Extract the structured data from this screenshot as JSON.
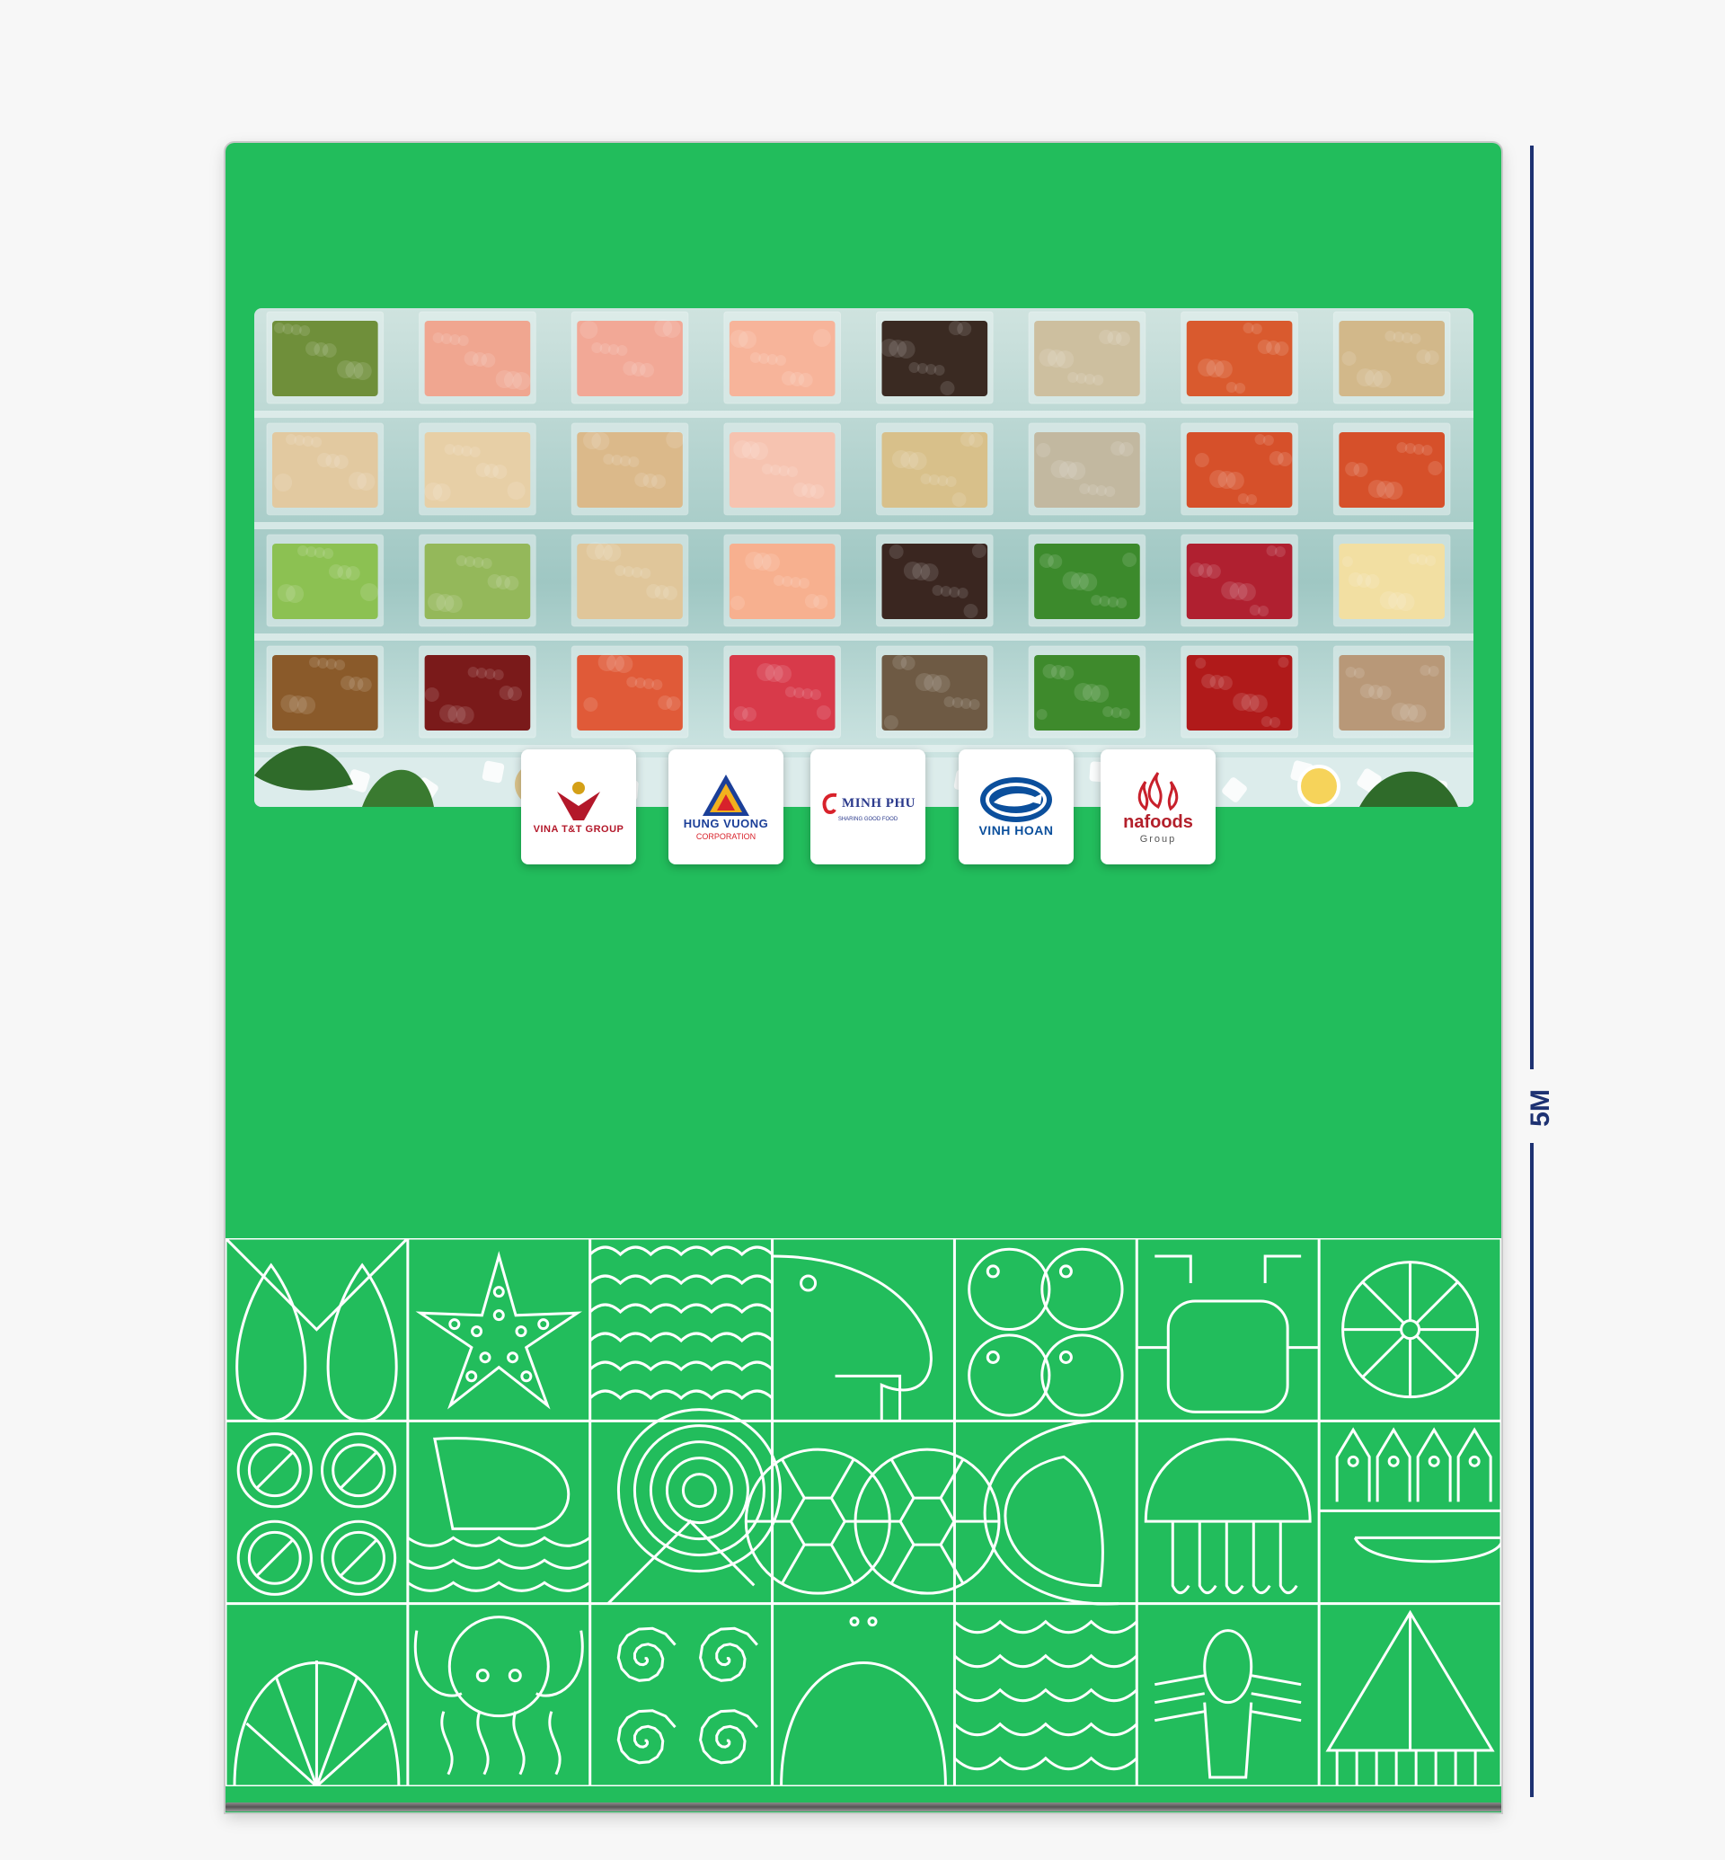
{
  "dimension": {
    "label": "5M",
    "color": "#1e3272"
  },
  "colors": {
    "panel": "#22bd5c",
    "pattern_line": "#ffffff",
    "background": "#f7f7f7"
  },
  "logos": [
    {
      "name": "VINA T&T GROUP",
      "subtitle": "",
      "color": "#b3182a",
      "icon": "person-icon"
    },
    {
      "name": "HUNG VUONG",
      "subtitle": "CORPORATION",
      "color": "#1b3f98",
      "icon": "triangle-icon"
    },
    {
      "name": "MINH PHU",
      "subtitle": "SHARING GOOD FOOD",
      "color": "#2b3a8c",
      "icon": "shrimp-icon"
    },
    {
      "name": "VINH HOAN",
      "subtitle": "",
      "color": "#0b4f9c",
      "icon": "fish-icon"
    },
    {
      "name": "nafoods",
      "subtitle": "Group",
      "color": "#c8202b",
      "icon": "flame-icon"
    }
  ],
  "photo": {
    "description_icons": "food-grid-icon",
    "items": [
      [
        "#6f8f3a",
        "#f0a690",
        "#f2a896",
        "#f7b49a",
        "#3a2a22",
        "#cdbf9f",
        "#d95a2e",
        "#d2b88a"
      ],
      [
        "#e2c9a0",
        "#e7cfa6",
        "#dbb98a",
        "#f6c3b0",
        "#d8c08a",
        "#c2b8a0",
        "#d6502a",
        "#d6502a"
      ],
      [
        "#8cc152",
        "#94b85a",
        "#e0c69a",
        "#f7b08f",
        "#3a2620",
        "#3c8a2c",
        "#b02030",
        "#f2dfa2"
      ],
      [
        "#8a5a2a",
        "#7a1a1a",
        "#e05a38",
        "#d83a4a",
        "#6e5a44",
        "#3e8a2c",
        "#b01a1a",
        "#b89878"
      ]
    ]
  }
}
